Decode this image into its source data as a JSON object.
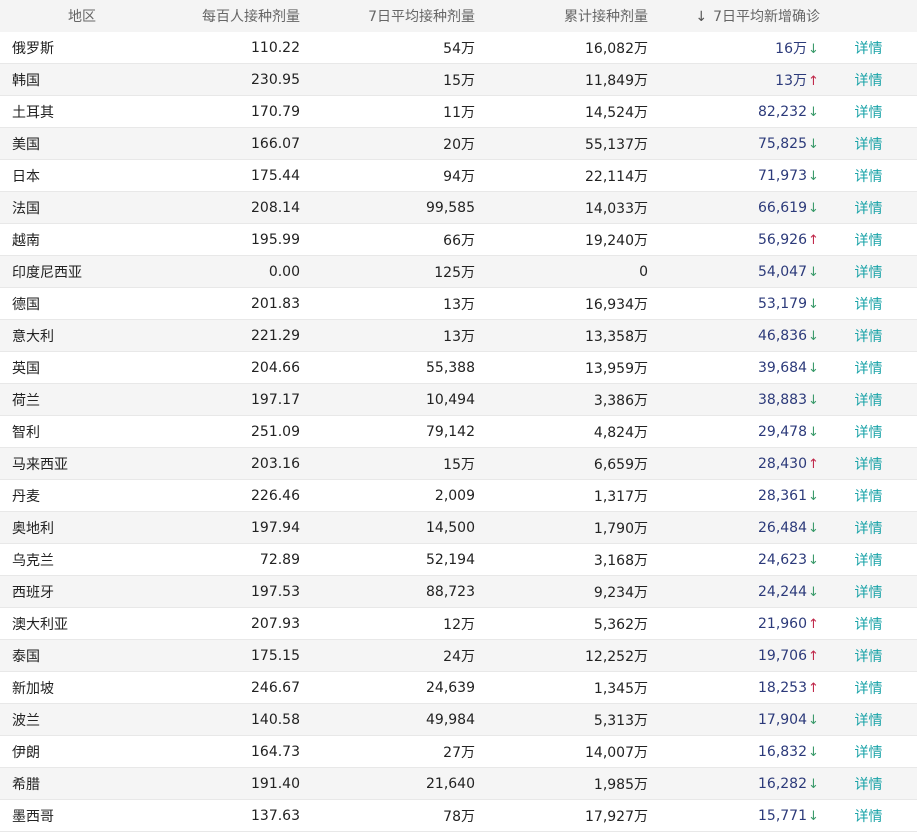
{
  "header": {
    "region": "地区",
    "per_hundred": "每百人接种剂量",
    "avg7_dose": "7日平均接种剂量",
    "total_dose": "累计接种剂量",
    "sort_icon": "↓",
    "avg7_confirmed": "7日平均新增确诊"
  },
  "detail_label": "详情",
  "colors": {
    "up": "#c0284a",
    "down": "#3a9a6a",
    "link": "#1aa3a8",
    "confirmed": "#2c3a7a"
  },
  "rows": [
    {
      "region": "俄罗斯",
      "per_hundred": "110.22",
      "avg7": "54万",
      "total": "16,082万",
      "confirmed": "16万",
      "trend": "down"
    },
    {
      "region": "韩国",
      "per_hundred": "230.95",
      "avg7": "15万",
      "total": "11,849万",
      "confirmed": "13万",
      "trend": "up"
    },
    {
      "region": "土耳其",
      "per_hundred": "170.79",
      "avg7": "11万",
      "total": "14,524万",
      "confirmed": "82,232",
      "trend": "down"
    },
    {
      "region": "美国",
      "per_hundred": "166.07",
      "avg7": "20万",
      "total": "55,137万",
      "confirmed": "75,825",
      "trend": "down"
    },
    {
      "region": "日本",
      "per_hundred": "175.44",
      "avg7": "94万",
      "total": "22,114万",
      "confirmed": "71,973",
      "trend": "down"
    },
    {
      "region": "法国",
      "per_hundred": "208.14",
      "avg7": "99,585",
      "total": "14,033万",
      "confirmed": "66,619",
      "trend": "down"
    },
    {
      "region": "越南",
      "per_hundred": "195.99",
      "avg7": "66万",
      "total": "19,240万",
      "confirmed": "56,926",
      "trend": "up"
    },
    {
      "region": "印度尼西亚",
      "per_hundred": "0.00",
      "avg7": "125万",
      "total": "0",
      "confirmed": "54,047",
      "trend": "down"
    },
    {
      "region": "德国",
      "per_hundred": "201.83",
      "avg7": "13万",
      "total": "16,934万",
      "confirmed": "53,179",
      "trend": "down"
    },
    {
      "region": "意大利",
      "per_hundred": "221.29",
      "avg7": "13万",
      "total": "13,358万",
      "confirmed": "46,836",
      "trend": "down"
    },
    {
      "region": "英国",
      "per_hundred": "204.66",
      "avg7": "55,388",
      "total": "13,959万",
      "confirmed": "39,684",
      "trend": "down"
    },
    {
      "region": "荷兰",
      "per_hundred": "197.17",
      "avg7": "10,494",
      "total": "3,386万",
      "confirmed": "38,883",
      "trend": "down"
    },
    {
      "region": "智利",
      "per_hundred": "251.09",
      "avg7": "79,142",
      "total": "4,824万",
      "confirmed": "29,478",
      "trend": "down"
    },
    {
      "region": "马来西亚",
      "per_hundred": "203.16",
      "avg7": "15万",
      "total": "6,659万",
      "confirmed": "28,430",
      "trend": "up"
    },
    {
      "region": "丹麦",
      "per_hundred": "226.46",
      "avg7": "2,009",
      "total": "1,317万",
      "confirmed": "28,361",
      "trend": "down"
    },
    {
      "region": "奥地利",
      "per_hundred": "197.94",
      "avg7": "14,500",
      "total": "1,790万",
      "confirmed": "26,484",
      "trend": "down"
    },
    {
      "region": "乌克兰",
      "per_hundred": "72.89",
      "avg7": "52,194",
      "total": "3,168万",
      "confirmed": "24,623",
      "trend": "down"
    },
    {
      "region": "西班牙",
      "per_hundred": "197.53",
      "avg7": "88,723",
      "total": "9,234万",
      "confirmed": "24,244",
      "trend": "down"
    },
    {
      "region": "澳大利亚",
      "per_hundred": "207.93",
      "avg7": "12万",
      "total": "5,362万",
      "confirmed": "21,960",
      "trend": "up"
    },
    {
      "region": "泰国",
      "per_hundred": "175.15",
      "avg7": "24万",
      "total": "12,252万",
      "confirmed": "19,706",
      "trend": "up"
    },
    {
      "region": "新加坡",
      "per_hundred": "246.67",
      "avg7": "24,639",
      "total": "1,345万",
      "confirmed": "18,253",
      "trend": "up"
    },
    {
      "region": "波兰",
      "per_hundred": "140.58",
      "avg7": "49,984",
      "total": "5,313万",
      "confirmed": "17,904",
      "trend": "down"
    },
    {
      "region": "伊朗",
      "per_hundred": "164.73",
      "avg7": "27万",
      "total": "14,007万",
      "confirmed": "16,832",
      "trend": "down"
    },
    {
      "region": "希腊",
      "per_hundred": "191.40",
      "avg7": "21,640",
      "total": "1,985万",
      "confirmed": "16,282",
      "trend": "down"
    },
    {
      "region": "墨西哥",
      "per_hundred": "137.63",
      "avg7": "78万",
      "total": "17,927万",
      "confirmed": "15,771",
      "trend": "down"
    }
  ]
}
